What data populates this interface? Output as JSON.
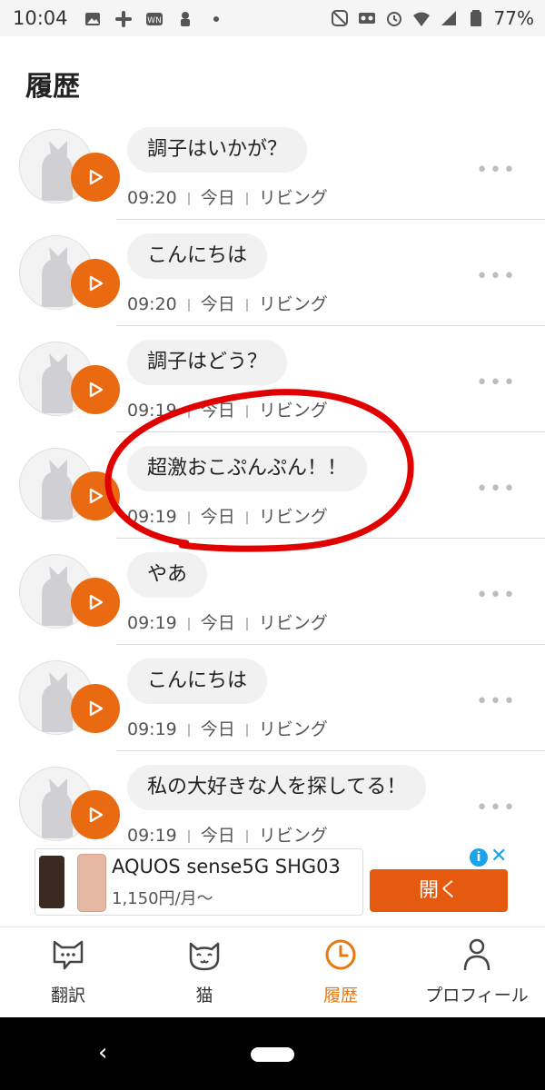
{
  "status_bar": {
    "time": "10:04",
    "battery": "77%",
    "icons_left": [
      "image-icon",
      "slack-icon",
      "app-icon",
      "app-icon",
      "dot-icon"
    ],
    "icons_right": [
      "nfc-icon",
      "voicemail-icon",
      "alarm-icon",
      "wifi-icon",
      "signal-icon",
      "battery-icon"
    ]
  },
  "page": {
    "title": "履歴"
  },
  "history": [
    {
      "message": "調子はいかが？",
      "time": "09:20",
      "day": "今日",
      "room": "リビング"
    },
    {
      "message": "こんにちは",
      "time": "09:20",
      "day": "今日",
      "room": "リビング"
    },
    {
      "message": "調子はどう？",
      "time": "09:19",
      "day": "今日",
      "room": "リビング"
    },
    {
      "message": "超激おこぷんぷん！！",
      "time": "09:19",
      "day": "今日",
      "room": "リビング"
    },
    {
      "message": "やあ",
      "time": "09:19",
      "day": "今日",
      "room": "リビング"
    },
    {
      "message": "こんにちは",
      "time": "09:19",
      "day": "今日",
      "room": "リビング"
    },
    {
      "message": "私の大好きな人を探してる！",
      "time": "09:19",
      "day": "今日",
      "room": "リビング"
    }
  ],
  "ad": {
    "title": "AQUOS sense5G SHG03",
    "price": "1,150円/月～",
    "button": "開く",
    "info_glyph": "i",
    "close_glyph": "✕"
  },
  "bottom_nav": [
    {
      "label": "翻訳",
      "icon": "speech-cat-icon",
      "active": false
    },
    {
      "label": "猫",
      "icon": "cat-face-icon",
      "active": false
    },
    {
      "label": "履歴",
      "icon": "clock-icon",
      "active": true
    },
    {
      "label": "プロフィール",
      "icon": "person-icon",
      "active": false
    }
  ],
  "colors": {
    "accent": "#e6790f",
    "play_button": "#ea6a12",
    "annotation": "#e00000",
    "ad_button": "#e65a0f"
  }
}
